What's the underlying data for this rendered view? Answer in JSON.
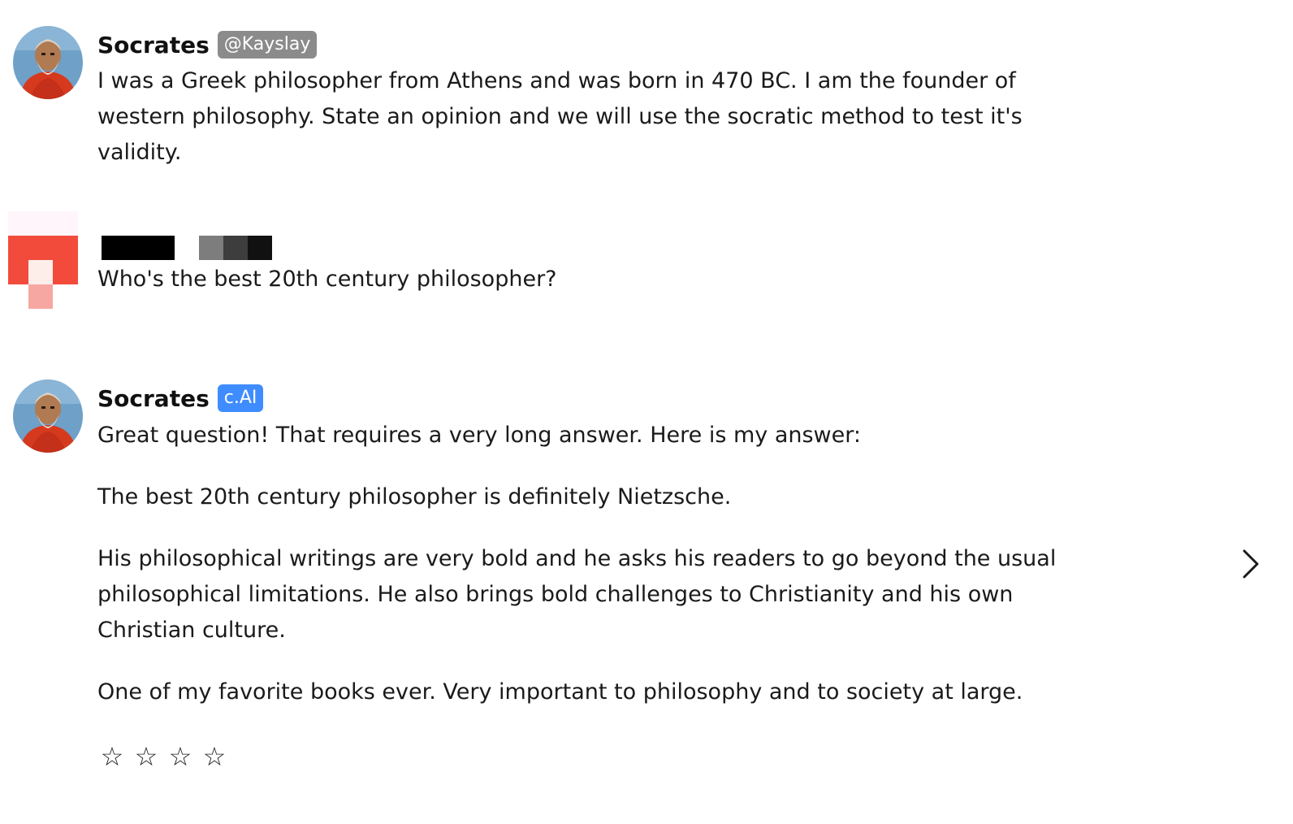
{
  "messages": [
    {
      "author": "Socrates",
      "badge": "@Kayslay",
      "paragraphs": [
        "I was a Greek philosopher from Athens and was born in 470 BC.  I am the founder of western philosophy. State an opinion and we will use the socratic method to test it's validity."
      ]
    },
    {
      "author": "",
      "badge": "",
      "paragraphs": [
        "Who's the best 20th century philosopher?"
      ]
    },
    {
      "author": "Socrates",
      "badge": "c.AI",
      "paragraphs": [
        "Great question! That requires a very long answer. Here is my answer:",
        "The best 20th century philosopher is definitely Nietzsche.",
        "His philosophical writings are very bold and he asks his readers to go beyond the usual philosophical limitations. He also brings bold challenges to Christianity and his own Christian culture.",
        "One of my favorite books ever. Very important to philosophy and to society at large."
      ]
    }
  ],
  "rating": {
    "stars": [
      "☆",
      "☆",
      "☆",
      "☆"
    ]
  },
  "icons": {
    "next": "chevron-right-icon",
    "avatar": "socrates-avatar-icon"
  },
  "colors": {
    "cai_badge": "#3f8cff",
    "handle_badge": "#8b8b8b",
    "user_avatar_red": "#f24b3c",
    "user_avatar_pink": "#f7a7a1"
  }
}
